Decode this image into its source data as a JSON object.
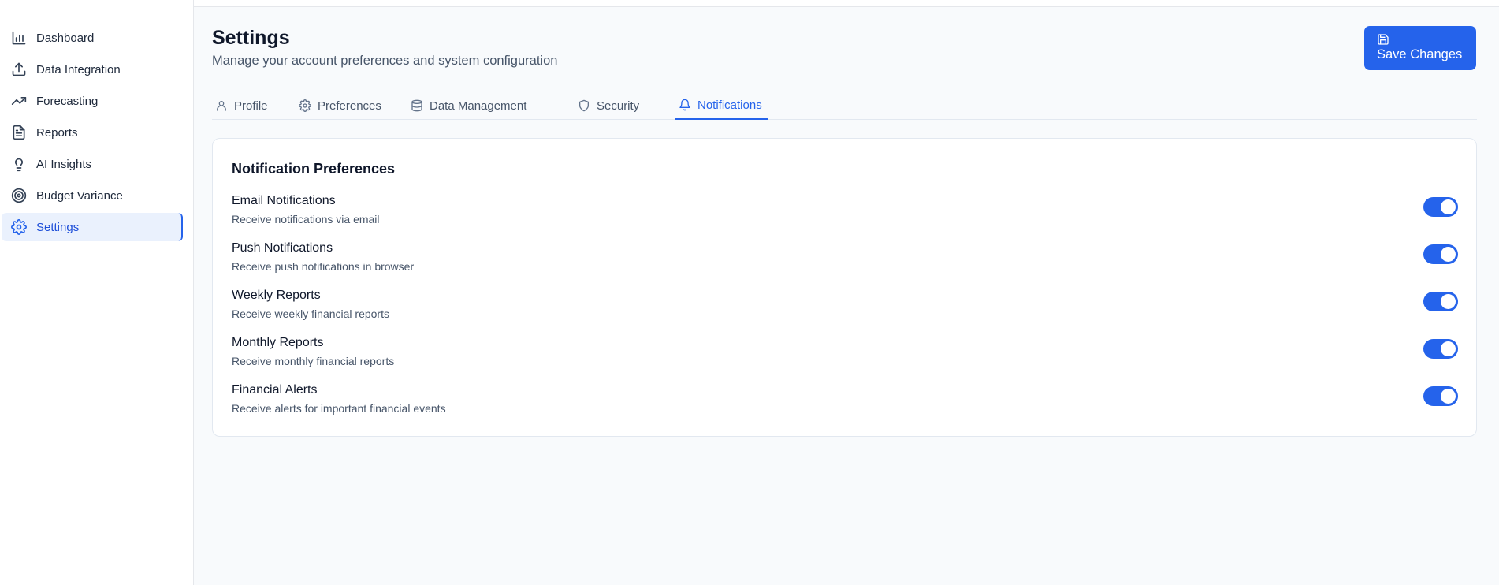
{
  "sidebar": {
    "items": [
      {
        "label": "Dashboard",
        "icon": "bar-chart-icon"
      },
      {
        "label": "Data Integration",
        "icon": "upload-icon"
      },
      {
        "label": "Forecasting",
        "icon": "trending-up-icon"
      },
      {
        "label": "Reports",
        "icon": "file-text-icon"
      },
      {
        "label": "AI Insights",
        "icon": "lightbulb-icon"
      },
      {
        "label": "Budget Variance",
        "icon": "target-icon"
      },
      {
        "label": "Settings",
        "icon": "gear-icon",
        "active": true
      }
    ]
  },
  "header": {
    "title": "Settings",
    "subtitle": "Manage your account preferences and system configuration",
    "save_label": "Save Changes"
  },
  "tabs": [
    {
      "label": "Profile",
      "icon": "user-icon"
    },
    {
      "label": "Preferences",
      "icon": "gear-icon"
    },
    {
      "label": "Data Management",
      "icon": "database-icon"
    },
    {
      "label": "Security",
      "icon": "shield-icon"
    },
    {
      "label": "Notifications",
      "icon": "bell-icon",
      "active": true
    }
  ],
  "card": {
    "title": "Notification Preferences",
    "settings": [
      {
        "name": "Email Notifications",
        "desc": "Receive notifications via email",
        "enabled": true
      },
      {
        "name": "Push Notifications",
        "desc": "Receive push notifications in browser",
        "enabled": true
      },
      {
        "name": "Weekly Reports",
        "desc": "Receive weekly financial reports",
        "enabled": true
      },
      {
        "name": "Monthly Reports",
        "desc": "Receive monthly financial reports",
        "enabled": true
      },
      {
        "name": "Financial Alerts",
        "desc": "Receive alerts for important financial events",
        "enabled": true
      }
    ]
  },
  "colors": {
    "accent": "#2563eb",
    "active_nav_bg": "#eaf1fd",
    "page_bg": "#f8fafc"
  }
}
